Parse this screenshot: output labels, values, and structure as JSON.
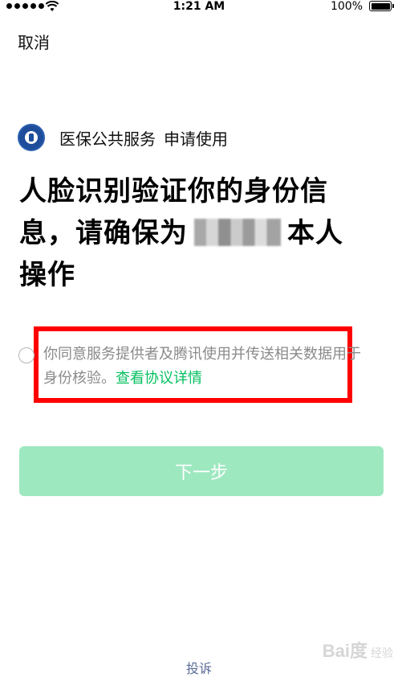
{
  "status_bar": {
    "time": "1:21 AM",
    "battery_percent": "100%",
    "battery_level": 1.0,
    "signal_bars": 5
  },
  "nav": {
    "cancel_label": "取消"
  },
  "app": {
    "name": "医保公共服务",
    "request_text": "申请使用",
    "logo_icon": "medical-insurance-logo-icon"
  },
  "headline": {
    "part1": "人脸识别验证你的身份信息，请确保为",
    "part2": "本人操作"
  },
  "consent": {
    "text": "你同意服务提供者及腾讯使用并传送相关数据用于身份核验。",
    "link_label": "查看协议详情",
    "checked": false,
    "link_color": "#07c160",
    "highlight_color": "#ff0000"
  },
  "next_button": {
    "label": "下一步",
    "color": "#9ee8c0",
    "enabled": false
  },
  "footer": {
    "complaint_label": "投诉"
  },
  "watermark": {
    "brand": "Bai度",
    "suffix": "经验"
  }
}
